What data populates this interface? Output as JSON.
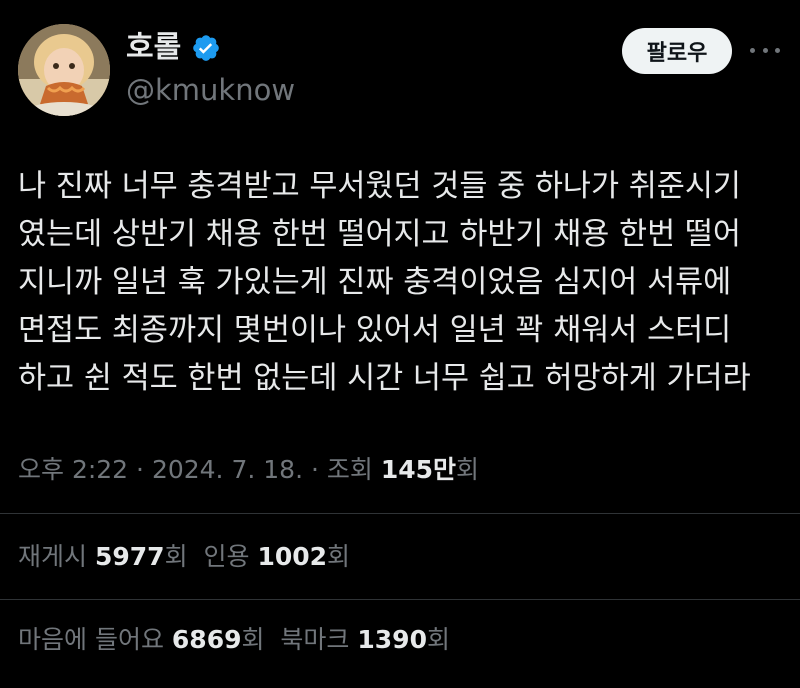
{
  "author": {
    "display_name": "호롤",
    "handle": "@kmuknow",
    "verified": true,
    "avatar_icon": "avatar-photo-child-eating-noodles"
  },
  "header": {
    "follow_label": "팔로우",
    "more_icon": "more-horizontal-icon"
  },
  "tweet": {
    "lines": [
      "나 진짜 너무 충격받고 무서웠던 것들 중 하나가 취준시기",
      "였는데 상반기 채용 한번 떨어지고 하반기 채용 한번 떨어",
      "지니까 일년 훅 가있는게 진짜 충격이었음 심지어 서류에",
      "면접도 최종까지 몇번이나 있어서 일년 꽉 채워서 스터디",
      "하고 쉰 적도 한번 없는데 시간 너무 쉽고 허망하게 가더라"
    ]
  },
  "meta": {
    "time": "오후 2:22",
    "separator": " · ",
    "date": "2024. 7. 18.",
    "views_label": "조회",
    "views_value": "145만",
    "views_suffix": "회"
  },
  "stats": {
    "retweets_label": "재게시",
    "retweets_value": "5977",
    "retweets_suffix": "회",
    "quotes_label": "인용",
    "quotes_value": "1002",
    "quotes_suffix": "회",
    "likes_label": "마음에 들어요",
    "likes_value": "6869",
    "likes_suffix": "회",
    "bookmarks_label": "북마크",
    "bookmarks_value": "1390",
    "bookmarks_suffix": "회"
  },
  "colors": {
    "background": "#000000",
    "primary_text": "#e7e9ea",
    "secondary_text": "#71767b",
    "verified_blue": "#1d9bf0",
    "divider": "#2f3336",
    "follow_button_bg": "#eff3f4"
  }
}
